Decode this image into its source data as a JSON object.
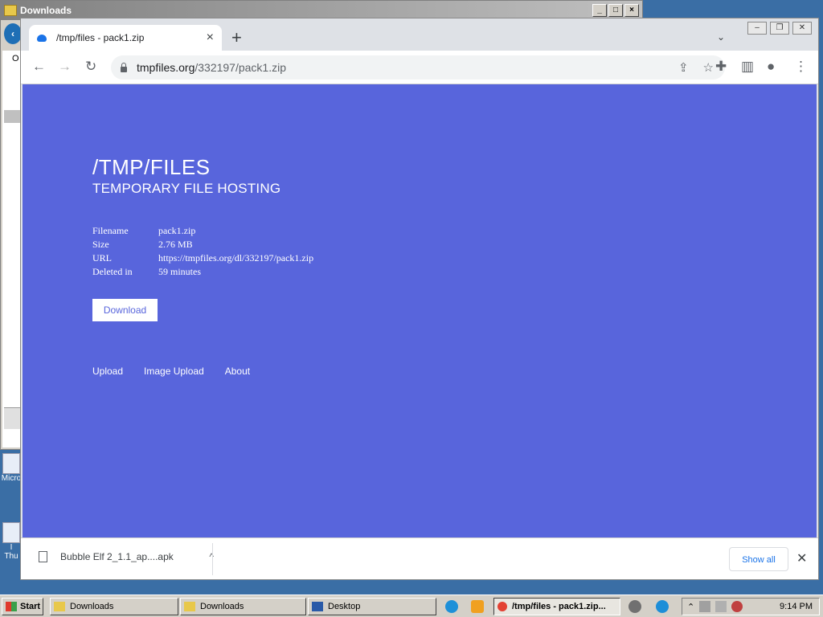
{
  "background_window": {
    "title": "Downloads",
    "controls": [
      "_",
      "□",
      "×"
    ],
    "side_letter": "O"
  },
  "desktop_icons": [
    {
      "label": "Micro"
    },
    {
      "label": "I\nThu"
    }
  ],
  "browser": {
    "tab": {
      "title": "/tmp/files - pack1.zip",
      "close": "×"
    },
    "new_tab": "+",
    "tab_search": "⌄",
    "window_controls": [
      "–",
      "❐",
      "✕"
    ],
    "nav": {
      "back": "←",
      "forward": "→",
      "reload": "↻"
    },
    "url": {
      "host": "tmpfiles.org",
      "path": "/332197/pack1.zip"
    },
    "omnibox_icons": {
      "share": "⇪",
      "bookmark": "☆"
    },
    "toolbar_icons": {
      "extensions": "✚",
      "sidepanel": "▥",
      "profile": "●",
      "menu": "⋮"
    }
  },
  "page": {
    "title": "/TMP/FILES",
    "subtitle": "TEMPORARY FILE HOSTING",
    "file_info": [
      {
        "key": "Filename",
        "value": "pack1.zip"
      },
      {
        "key": "Size",
        "value": "2.76 MB"
      },
      {
        "key": "URL",
        "value": "https://tmpfiles.org/dl/332197/pack1.zip"
      },
      {
        "key": "Deleted in",
        "value": "59 minutes"
      }
    ],
    "download_button": "Download",
    "footer_nav": [
      "Upload",
      "Image Upload",
      "About"
    ]
  },
  "download_bar": {
    "filename": "Bubble Elf 2_1.1_ap....apk",
    "chevron": "^",
    "show_all": "Show all",
    "close": "✕"
  },
  "taskbar": {
    "start": "Start",
    "buttons": [
      "Downloads",
      "Downloads",
      "Desktop",
      "/tmp/files - pack1.zip..."
    ],
    "clock": "9:14 PM"
  },
  "colors": {
    "page_bg": "#5865dc",
    "accent_blue": "#1a73e8"
  }
}
